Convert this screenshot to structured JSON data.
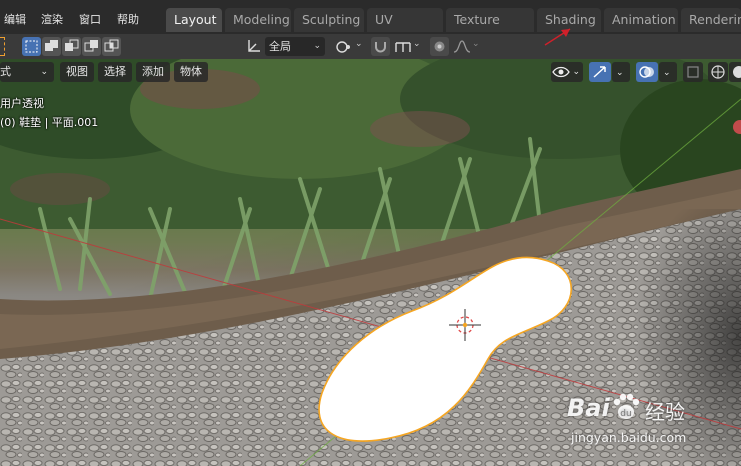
{
  "menu": [
    "编辑",
    "渲染",
    "窗口",
    "帮助"
  ],
  "workspace_tabs": [
    "Layout",
    "Modeling",
    "Sculpting",
    "UV Editing",
    "Texture Paint",
    "Shading",
    "Animation",
    "Renderin"
  ],
  "active_tab": "Layout",
  "toolbar": {
    "transform_orientation": "全局"
  },
  "viewport_header": {
    "mode": "式",
    "view": "视图",
    "select": "选择",
    "add": "添加",
    "object": "物体"
  },
  "viewport_overlay": {
    "view_name": "用户透视",
    "object_info": "(0) 鞋垫 | 平面.001"
  },
  "watermark": {
    "brand": "Bai",
    "brand2": "经验",
    "url": "jingyan.baidu.com"
  },
  "colors": {
    "accent": "#4772b3",
    "selection_outline": "#f5a623",
    "annotation_arrow": "#d0202a"
  }
}
